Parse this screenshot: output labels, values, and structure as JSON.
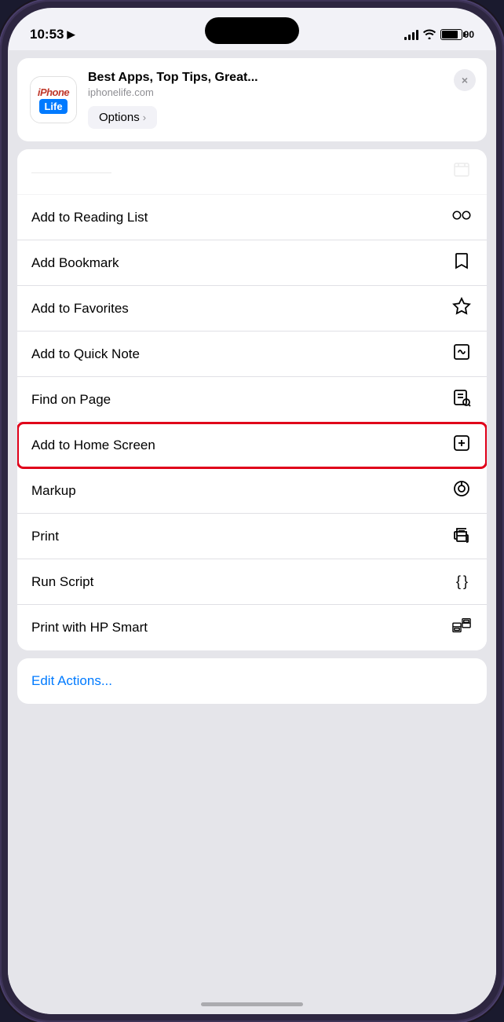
{
  "statusBar": {
    "time": "10:53",
    "batteryLevel": "90",
    "batteryPercent": 90
  },
  "shareHeader": {
    "appIconTop": "iPhone",
    "appIconBottom": "Life",
    "title": "Best Apps, Top Tips, Great...",
    "url": "iphonelife.com",
    "optionsLabel": "Options",
    "closeLabel": "×"
  },
  "menuSections": {
    "section1": {
      "items": [
        {
          "label": "Add to Reading List",
          "icon": "reading-list"
        },
        {
          "label": "Add Bookmark",
          "icon": "bookmark"
        },
        {
          "label": "Add to Favorites",
          "icon": "star"
        },
        {
          "label": "Add to Quick Note",
          "icon": "quick-note"
        },
        {
          "label": "Find on Page",
          "icon": "find-on-page"
        },
        {
          "label": "Add to Home Screen",
          "icon": "add-home",
          "highlighted": true
        },
        {
          "label": "Markup",
          "icon": "markup"
        },
        {
          "label": "Print",
          "icon": "print"
        },
        {
          "label": "Run Script",
          "icon": "run-script"
        },
        {
          "label": "Print with HP Smart",
          "icon": "hp-smart"
        }
      ]
    }
  },
  "editActions": {
    "label": "Edit Actions..."
  }
}
